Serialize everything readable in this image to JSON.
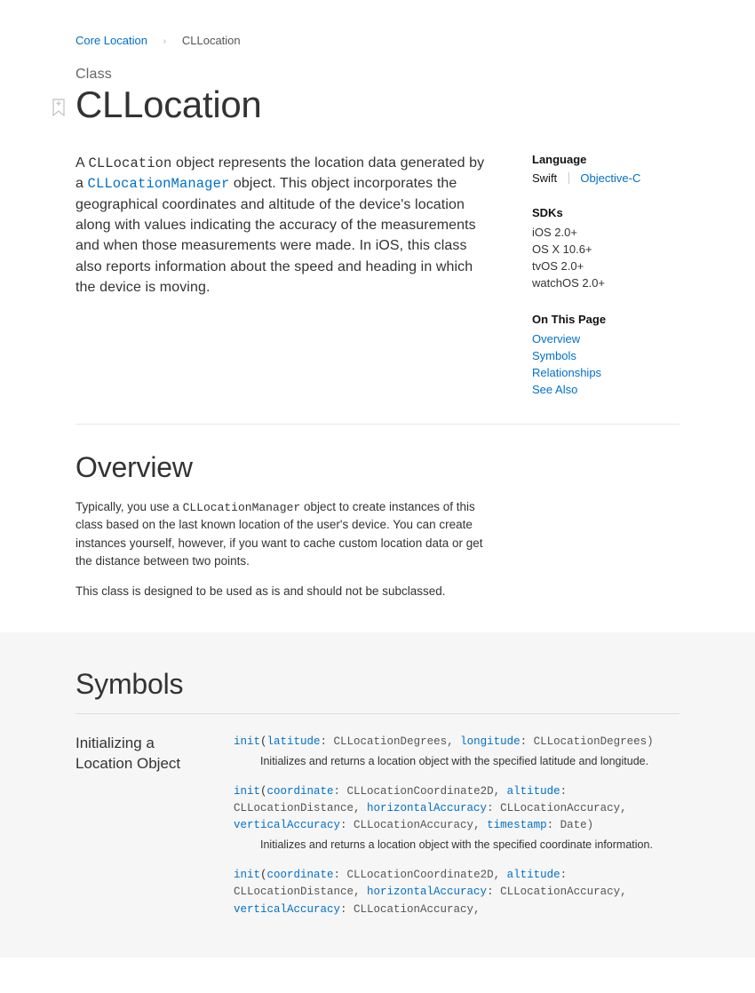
{
  "breadcrumb": {
    "parent": "Core Location",
    "current": "CLLocation"
  },
  "eyebrow": "Class",
  "title": "CLLocation",
  "intro": {
    "p1a": "A ",
    "code1": "CLLocation",
    "p1b": " object represents the location data generated by a ",
    "link1": "CLLocationManager",
    "p1c": " object. This object incorporates the geographical coordinates and altitude of the device's location along with values indicating the accuracy of the measurements and when those measurements were made. In iOS, this class also reports information about the speed and heading in which the device is moving."
  },
  "aside": {
    "lang_heading": "Language",
    "lang_selected": "Swift",
    "lang_other": "Objective-C",
    "sdks_heading": "SDKs",
    "sdks": [
      "iOS 2.0+",
      "OS X 10.6+",
      "tvOS 2.0+",
      "watchOS 2.0+"
    ],
    "otp_heading": "On This Page",
    "otp": [
      "Overview",
      "Symbols",
      "Relationships",
      "See Also"
    ]
  },
  "overview": {
    "heading": "Overview",
    "p1a": "Typically, you use a ",
    "code1": "CLLocationManager",
    "p1b": " object to create instances of this class based on the last known location of the user's device. You can create instances yourself, however, if you want to cache custom location data or get the distance between two points.",
    "p2": "This class is designed to be used as is and should not be subclassed."
  },
  "symbols": {
    "heading": "Symbols",
    "group_label": "Initializing a Location Object",
    "d1": {
      "kw": "init",
      "t1": "(",
      "p1": "latitude",
      "t2": ": CLLocationDegrees, ",
      "p2": "longitude",
      "t3": ": CLLocationDegrees)",
      "desc": "Initializes and returns a location object with the specified latitude and longitude."
    },
    "d2": {
      "kw": "init",
      "t1": "(",
      "p1": "coordinate",
      "t2": ": CLLocationCoordinate2D, ",
      "p2": "altitude",
      "t3": ": CLLocationDistance, ",
      "p3": "horizontalAccuracy",
      "t4": ": CLLocationAccuracy, ",
      "p4": "verticalAccuracy",
      "t5": ": CLLocationAccuracy, ",
      "p5": "timestamp",
      "t6": ": Date)",
      "desc": "Initializes and returns a location object with the specified coordinate information."
    },
    "d3": {
      "kw": "init",
      "t1": "(",
      "p1": "coordinate",
      "t2": ": CLLocationCoordinate2D, ",
      "p2": "altitude",
      "t3": ": CLLocationDistance, ",
      "p3": "horizontalAccuracy",
      "t4": ": CLLocationAccuracy, ",
      "p4": "verticalAccuracy",
      "t5": ": CLLocationAccuracy,"
    }
  }
}
